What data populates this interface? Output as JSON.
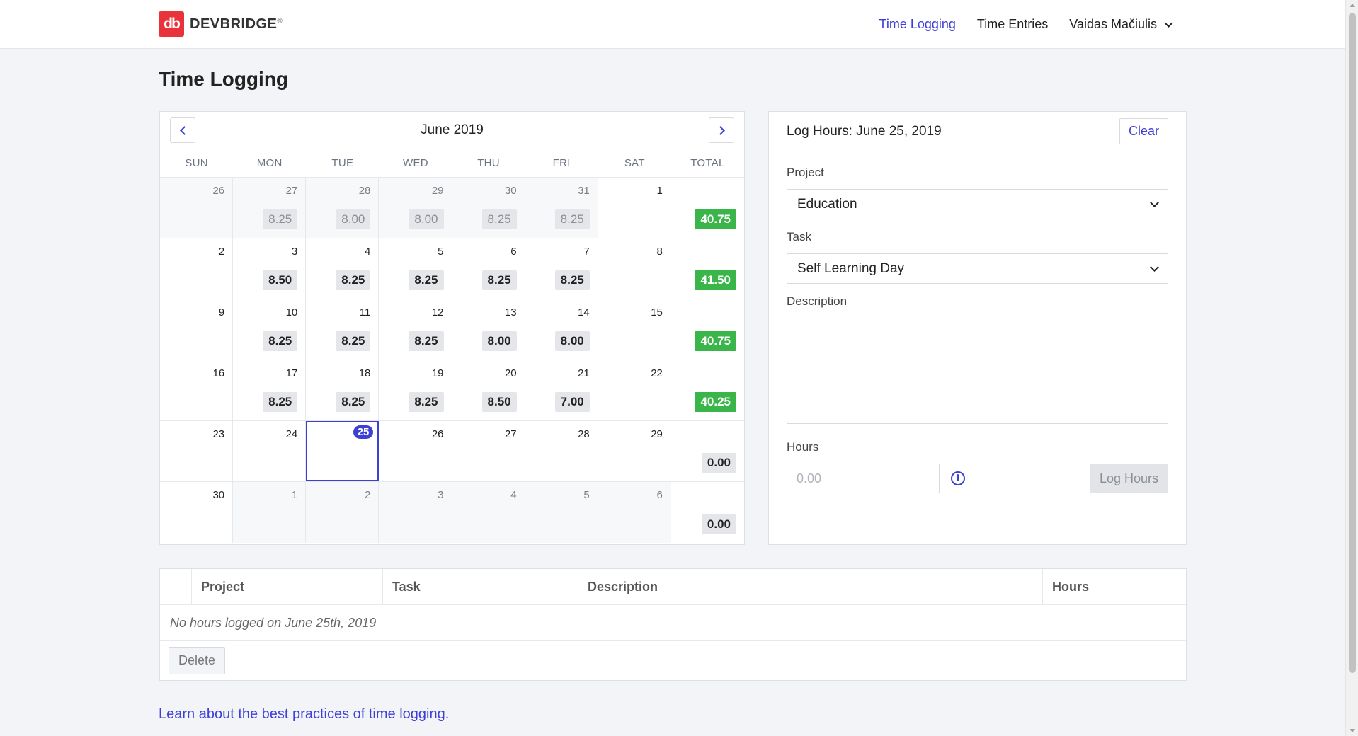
{
  "brand": {
    "logo_mark": "db",
    "name": "DEVBRIDGE",
    "mark": "®"
  },
  "nav": {
    "time_logging": "Time Logging",
    "time_entries": "Time Entries",
    "user_name": "Vaidas Mačiulis"
  },
  "page_title": "Time Logging",
  "calendar": {
    "month_label": "June 2019",
    "weekdays": [
      "SUN",
      "MON",
      "TUE",
      "WED",
      "THU",
      "FRI",
      "SAT",
      "TOTAL"
    ],
    "weeks": [
      {
        "days": [
          {
            "num": "26",
            "other": true,
            "hours": ""
          },
          {
            "num": "27",
            "other": true,
            "hours": "8.25"
          },
          {
            "num": "28",
            "other": true,
            "hours": "8.00"
          },
          {
            "num": "29",
            "other": true,
            "hours": "8.00"
          },
          {
            "num": "30",
            "other": true,
            "hours": "8.25"
          },
          {
            "num": "31",
            "other": true,
            "hours": "8.25"
          },
          {
            "num": "1",
            "other": false,
            "hours": ""
          }
        ],
        "total": "40.75",
        "total_green": true
      },
      {
        "days": [
          {
            "num": "2",
            "other": false,
            "hours": ""
          },
          {
            "num": "3",
            "other": false,
            "hours": "8.50"
          },
          {
            "num": "4",
            "other": false,
            "hours": "8.25"
          },
          {
            "num": "5",
            "other": false,
            "hours": "8.25"
          },
          {
            "num": "6",
            "other": false,
            "hours": "8.25"
          },
          {
            "num": "7",
            "other": false,
            "hours": "8.25"
          },
          {
            "num": "8",
            "other": false,
            "hours": ""
          }
        ],
        "total": "41.50",
        "total_green": true
      },
      {
        "days": [
          {
            "num": "9",
            "other": false,
            "hours": ""
          },
          {
            "num": "10",
            "other": false,
            "hours": "8.25"
          },
          {
            "num": "11",
            "other": false,
            "hours": "8.25"
          },
          {
            "num": "12",
            "other": false,
            "hours": "8.25"
          },
          {
            "num": "13",
            "other": false,
            "hours": "8.00"
          },
          {
            "num": "14",
            "other": false,
            "hours": "8.00"
          },
          {
            "num": "15",
            "other": false,
            "hours": ""
          }
        ],
        "total": "40.75",
        "total_green": true
      },
      {
        "days": [
          {
            "num": "16",
            "other": false,
            "hours": ""
          },
          {
            "num": "17",
            "other": false,
            "hours": "8.25"
          },
          {
            "num": "18",
            "other": false,
            "hours": "8.25"
          },
          {
            "num": "19",
            "other": false,
            "hours": "8.25"
          },
          {
            "num": "20",
            "other": false,
            "hours": "8.50"
          },
          {
            "num": "21",
            "other": false,
            "hours": "7.00"
          },
          {
            "num": "22",
            "other": false,
            "hours": ""
          }
        ],
        "total": "40.25",
        "total_green": true
      },
      {
        "days": [
          {
            "num": "23",
            "other": false,
            "hours": ""
          },
          {
            "num": "24",
            "other": false,
            "hours": ""
          },
          {
            "num": "25",
            "other": false,
            "hours": "",
            "today": true,
            "selected": true
          },
          {
            "num": "26",
            "other": false,
            "hours": ""
          },
          {
            "num": "27",
            "other": false,
            "hours": ""
          },
          {
            "num": "28",
            "other": false,
            "hours": ""
          },
          {
            "num": "29",
            "other": false,
            "hours": ""
          }
        ],
        "total": "0.00",
        "total_green": false
      },
      {
        "days": [
          {
            "num": "30",
            "other": false,
            "hours": ""
          },
          {
            "num": "1",
            "other": true,
            "hours": ""
          },
          {
            "num": "2",
            "other": true,
            "hours": ""
          },
          {
            "num": "3",
            "other": true,
            "hours": ""
          },
          {
            "num": "4",
            "other": true,
            "hours": ""
          },
          {
            "num": "5",
            "other": true,
            "hours": ""
          },
          {
            "num": "6",
            "other": true,
            "hours": ""
          }
        ],
        "total": "0.00",
        "total_green": false
      }
    ]
  },
  "log_form": {
    "title": "Log Hours: June 25, 2019",
    "clear_label": "Clear",
    "project_label": "Project",
    "project_value": "Education",
    "task_label": "Task",
    "task_value": "Self Learning Day",
    "description_label": "Description",
    "description_value": "",
    "hours_label": "Hours",
    "hours_placeholder": "0.00",
    "info_glyph": "i",
    "log_button": "Log Hours"
  },
  "entries": {
    "columns": [
      "Project",
      "Task",
      "Description",
      "Hours"
    ],
    "empty_message": "No hours logged on June 25th, 2019",
    "delete_label": "Delete"
  },
  "footer_link": "Learn about the best practices of time logging.",
  "colors": {
    "accent": "#3d3fd6",
    "brand_red": "#e8333b",
    "total_green": "#3ab54a",
    "page_bg": "#f2f4f7"
  }
}
